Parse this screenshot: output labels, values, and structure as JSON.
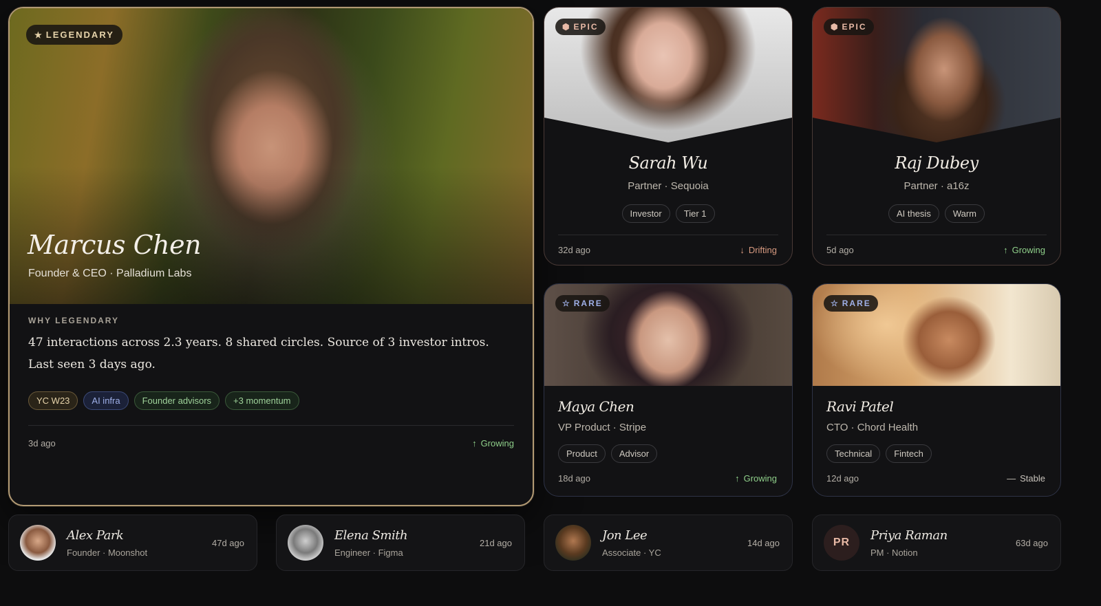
{
  "featured": {
    "badge": "LEGENDARY",
    "badge_icon": "star-icon",
    "name": "Marcus Chen",
    "role": "Founder & CEO · Palladium Labs",
    "why_label": "WHY LEGENDARY",
    "why_text": "47 interactions across 2.3 years. 8 shared circles. Source of 3 investor intros. Last seen 3 days ago.",
    "tags": [
      "YC W23",
      "AI infra",
      "Founder advisors",
      "+3 momentum"
    ],
    "last_seen": "3d ago",
    "trend": "Growing",
    "trend_icon": "arrow-up-icon"
  },
  "epic_cards": [
    {
      "badge": "EPIC",
      "badge_icon": "hexagon-icon",
      "name": "Sarah Wu",
      "role": "Partner · Sequoia",
      "tags": [
        "Investor",
        "Tier 1"
      ],
      "last_seen": "32d ago",
      "trend": "Drifting",
      "trend_icon": "arrow-down-icon"
    },
    {
      "badge": "EPIC",
      "badge_icon": "hexagon-icon",
      "name": "Raj Dubey",
      "role": "Partner · a16z",
      "tags": [
        "AI thesis",
        "Warm"
      ],
      "last_seen": "5d ago",
      "trend": "Growing",
      "trend_icon": "arrow-up-icon"
    }
  ],
  "rare_cards": [
    {
      "badge": "RARE",
      "badge_icon": "star-outline-icon",
      "name": "Maya Chen",
      "role": "VP Product · Stripe",
      "tags": [
        "Product",
        "Advisor"
      ],
      "last_seen": "18d ago",
      "trend": "Growing",
      "trend_icon": "arrow-up-icon"
    },
    {
      "badge": "RARE",
      "badge_icon": "star-outline-icon",
      "name": "Ravi Patel",
      "role": "CTO · Chord Health",
      "tags": [
        "Technical",
        "Fintech"
      ],
      "last_seen": "12d ago",
      "trend": "Stable",
      "trend_icon": "dash-icon"
    }
  ],
  "contacts": [
    {
      "name": "Alex Park",
      "role": "Founder · Moonshot",
      "last_seen": "47d ago",
      "avatar": "photo"
    },
    {
      "name": "Elena Smith",
      "role": "Engineer · Figma",
      "last_seen": "21d ago",
      "avatar": "photo"
    },
    {
      "name": "Jon Lee",
      "role": "Associate · YC",
      "last_seen": "14d ago",
      "avatar": "photo"
    },
    {
      "name": "Priya Raman",
      "role": "PM · Notion",
      "last_seen": "63d ago",
      "avatar": "PR"
    }
  ],
  "colors": {
    "background": "#0d0d0e",
    "legendary_accent": "#b29a74",
    "epic_accent": "#e8b9a6",
    "rare_accent": "#9fb0e8",
    "growing": "#8fcf8a",
    "drifting": "#d79a80"
  }
}
